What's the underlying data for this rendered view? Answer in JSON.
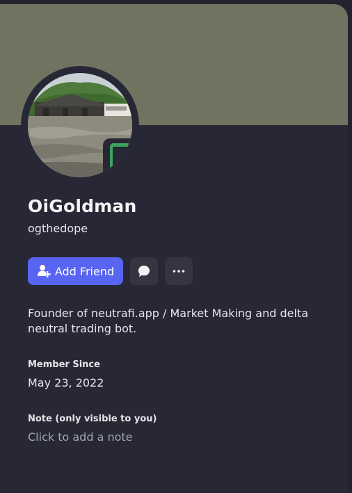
{
  "profile": {
    "display_name": "OiGoldman",
    "username": "ogthedope",
    "bio": "Founder of neutrafi.app / Market Making and delta neutral trading bot.",
    "status_icon": "mobile-phone-icon",
    "status_color": "#3ba55c"
  },
  "actions": {
    "add_friend_label": "Add Friend",
    "message_icon": "chat-bubble-icon",
    "more_icon": "ellipsis-icon"
  },
  "member_since": {
    "label": "Member Since",
    "value": "May 23, 2022"
  },
  "note": {
    "label": "Note (only visible to you)",
    "placeholder": "Click to add a note"
  },
  "colors": {
    "banner": "#6f7461",
    "accent": "#5865f2",
    "background": "#272735"
  }
}
